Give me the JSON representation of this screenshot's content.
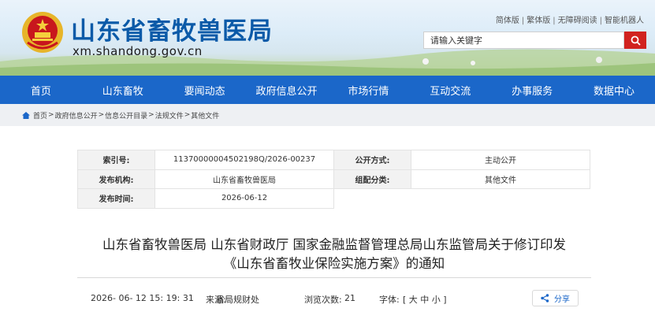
{
  "header": {
    "site_name": "山东省畜牧兽医局",
    "domain": "xm.shandong.gov.cn",
    "top_links": [
      "简体版",
      "繁体版",
      "无障碍阅读",
      "智能机器人"
    ],
    "search_placeholder": "请输入关键字"
  },
  "nav": [
    "首页",
    "山东畜牧",
    "要闻动态",
    "政府信息公开",
    "市场行情",
    "互动交流",
    "办事服务",
    "数据中心"
  ],
  "breadcrumb": [
    "首页",
    "政府信息公开",
    "信息公开目录",
    "法规文件",
    "其他文件"
  ],
  "meta": {
    "index_label": "索引号:",
    "index_value": "11370000004502198Q/2026-00237",
    "method_label": "公开方式:",
    "method_value": "主动公开",
    "org_label": "发布机构:",
    "org_value": "山东省畜牧兽医局",
    "category_label": "组配分类:",
    "category_value": "其他文件",
    "date_label": "发布时间:",
    "date_value": "2026-06-12"
  },
  "article": {
    "title_line1": "山东省畜牧兽医局 山东省财政厅 国家金融监督管理总局山东监管局关于修订印发",
    "title_line2": "《山东省畜牧业保险实施方案》的通知",
    "datetime": "2026- 06- 12 15: 19: 31",
    "source_label": "来源:",
    "source": "省局规财处",
    "views_label": "浏览次数:",
    "views": "21",
    "font_label": "字体:",
    "font_sizes": "[ 大 中 小 ]",
    "share_label": "分享"
  },
  "colors": {
    "nav_blue": "#1b67c9",
    "search_red": "#d1231f",
    "title_blue": "#0b5aa8"
  }
}
